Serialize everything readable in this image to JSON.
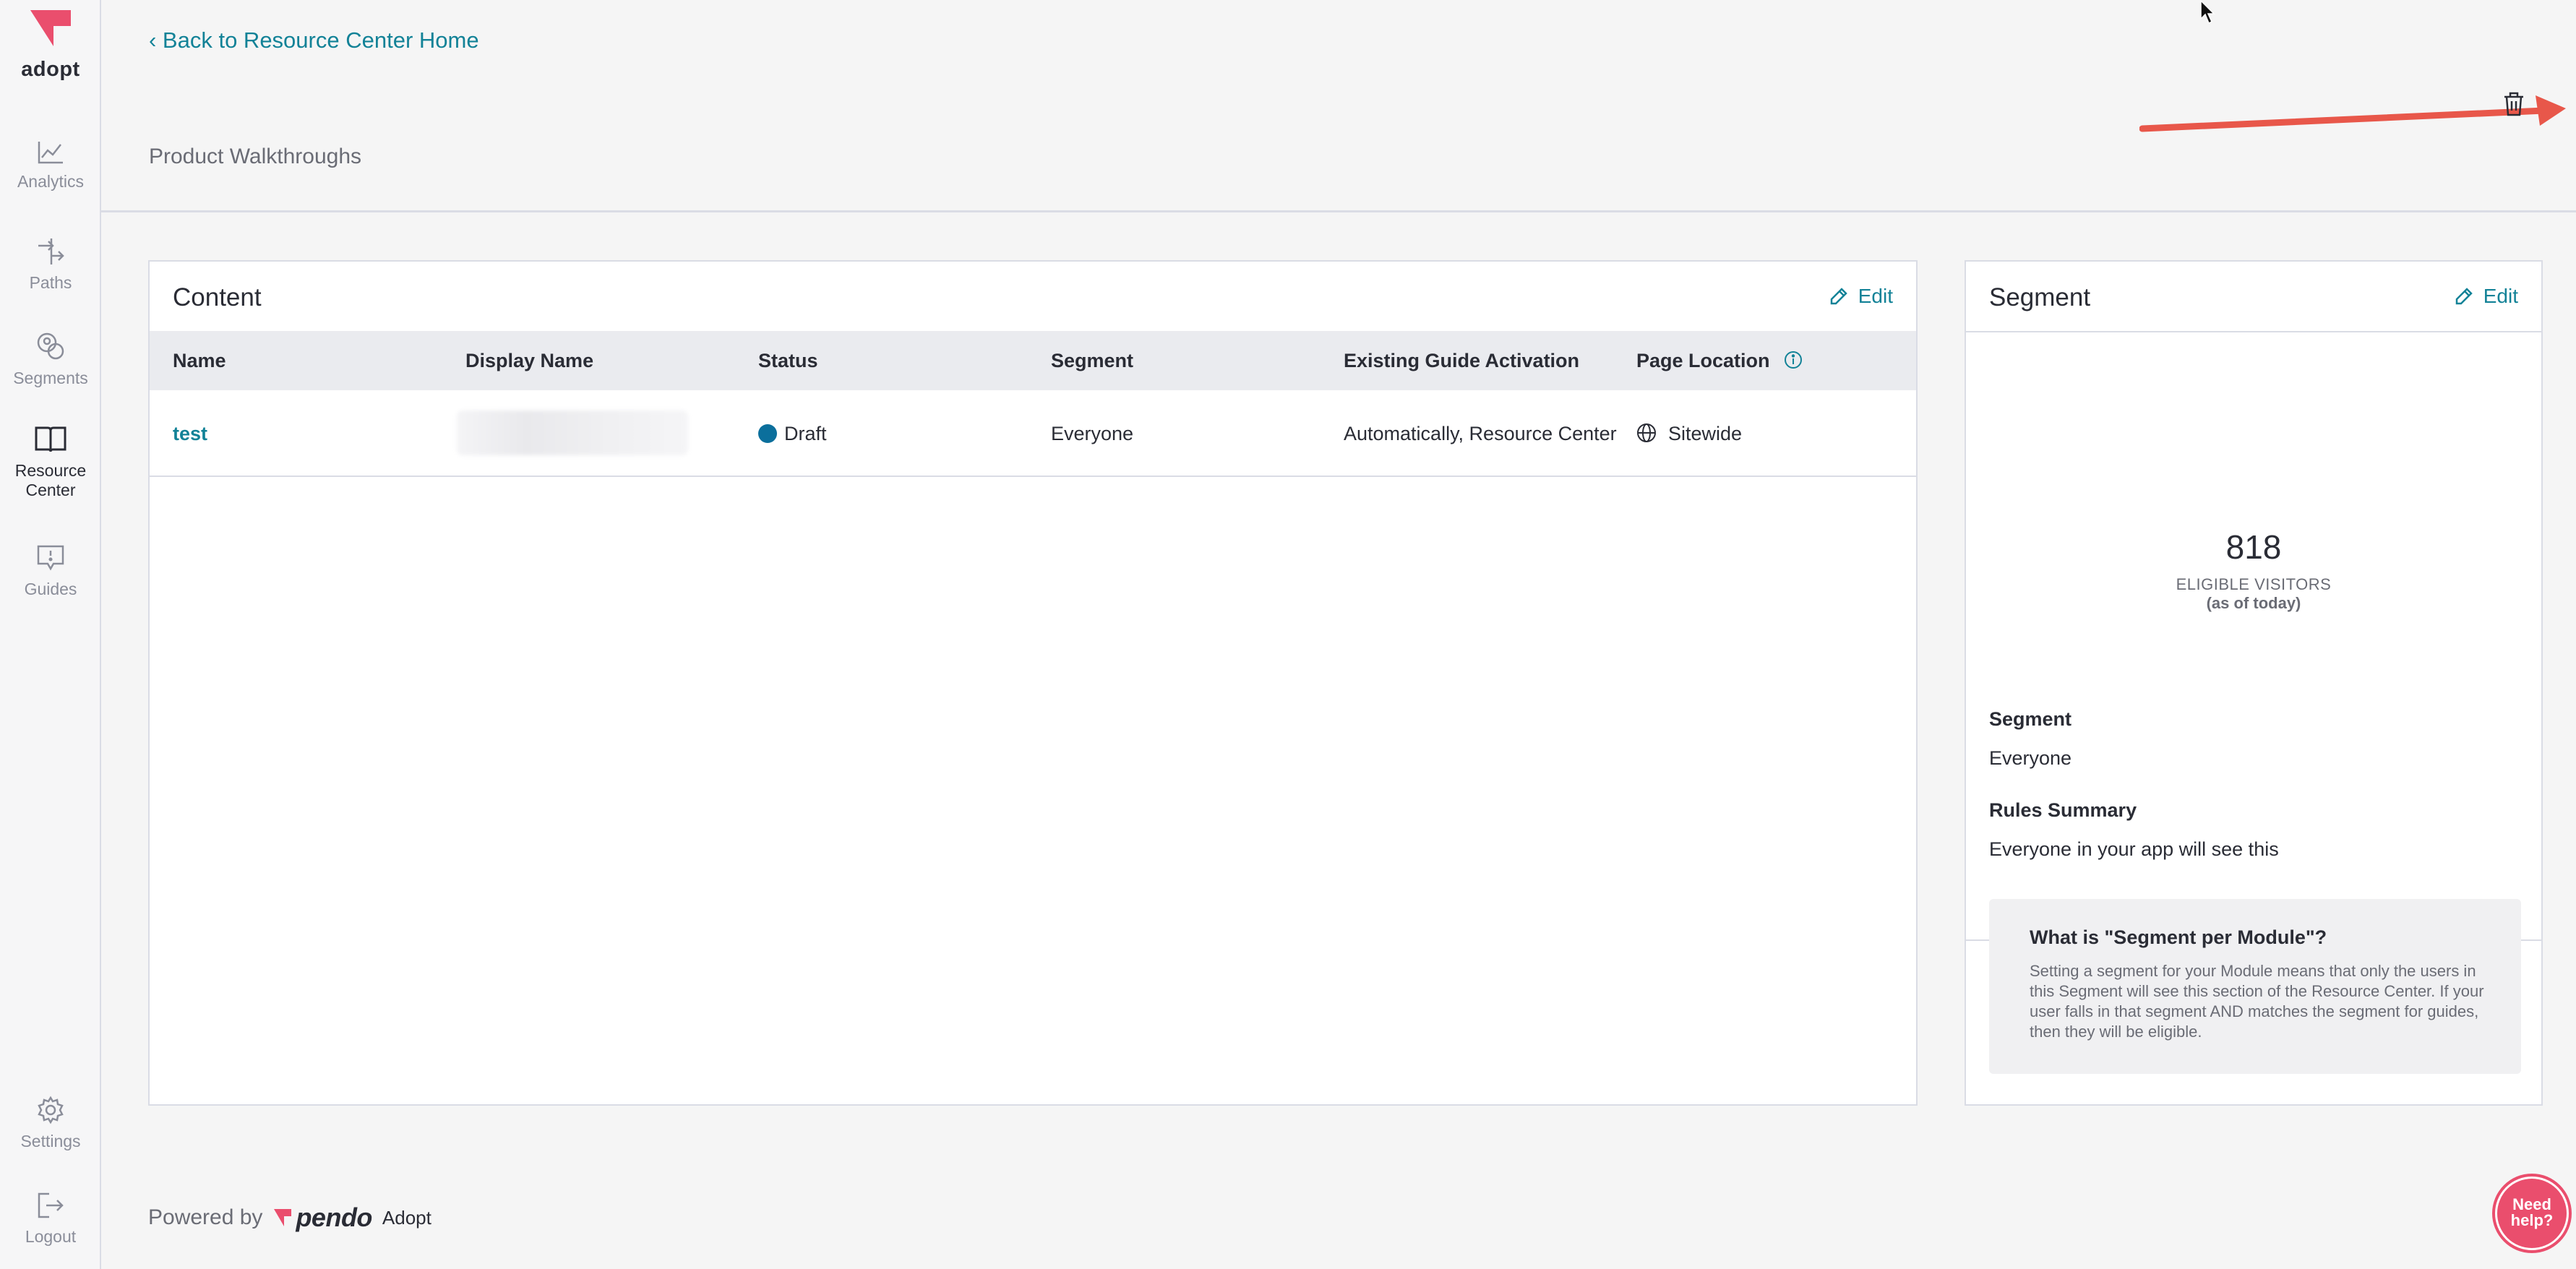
{
  "sidebar": {
    "brand": "adopt",
    "items": [
      {
        "label": "Analytics",
        "icon": "chart-line-icon"
      },
      {
        "label": "Paths",
        "icon": "paths-icon"
      },
      {
        "label": "Segments",
        "icon": "segments-icon"
      },
      {
        "label": "Resource Center",
        "icon": "book-icon",
        "active": true
      },
      {
        "label": "Guides",
        "icon": "guide-message-icon"
      },
      {
        "label": "Settings",
        "icon": "gear-icon"
      },
      {
        "label": "Logout",
        "icon": "logout-icon"
      }
    ]
  },
  "header": {
    "back_link": "‹ Back to Resource Center Home",
    "title": "Product Walkthroughs"
  },
  "content": {
    "title": "Content",
    "edit_label": "Edit",
    "columns": [
      "Name",
      "Display Name",
      "Status",
      "Segment",
      "Existing Guide Activation",
      "Page Location"
    ],
    "rows": [
      {
        "name": "test",
        "display_name": "",
        "status": "Draft",
        "segment": "Everyone",
        "activation": "Automatically, Resource Center",
        "page_location": "Sitewide"
      }
    ]
  },
  "segment_panel": {
    "title": "Segment",
    "edit_label": "Edit",
    "count": "818",
    "count_label": "ELIGIBLE VISITORS",
    "count_sub": "(as of today)",
    "segment_label": "Segment",
    "segment_value": "Everyone",
    "rules_label": "Rules Summary",
    "rules_value": "Everyone in your app will see this",
    "info_title": "What is \"Segment per Module\"?",
    "info_text": "Setting a segment for your Module means that only the users in this Segment will see this section of the Resource Center. If your user falls in that segment AND matches the segment for guides, then they will be eligible."
  },
  "footer": {
    "powered_by": "Powered by",
    "pendo": "pendo",
    "adopt": "Adopt"
  },
  "help": {
    "label": "Need help?"
  },
  "colors": {
    "accent": "#128297",
    "brand_pink": "#ea4e6d",
    "draft_status": "#0b6f9c",
    "annotation_arrow": "#e8574a"
  }
}
